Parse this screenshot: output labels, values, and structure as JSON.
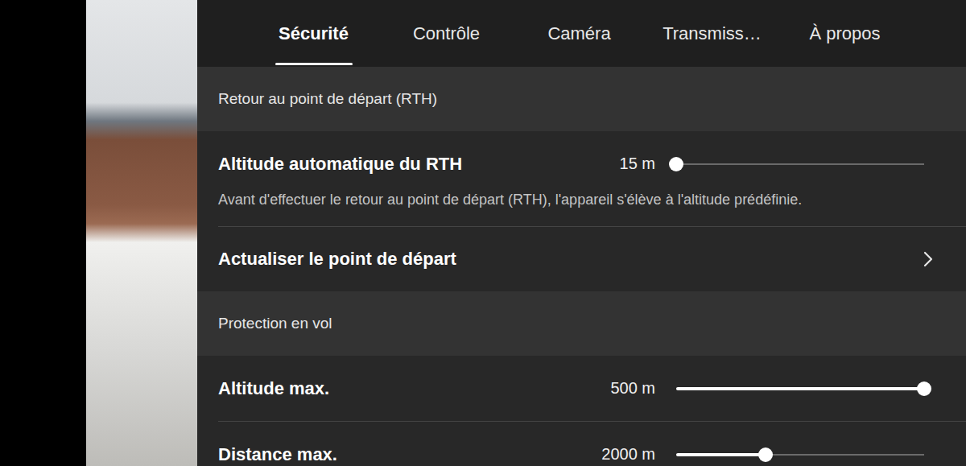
{
  "tabs": [
    {
      "label": "Sécurité",
      "selected": true
    },
    {
      "label": "Contrôle",
      "selected": false
    },
    {
      "label": "Caméra",
      "selected": false
    },
    {
      "label": "Transmiss…",
      "selected": false
    },
    {
      "label": "À propos",
      "selected": false
    }
  ],
  "sections": [
    {
      "title": "Retour au point de départ (RTH)",
      "rows": [
        {
          "kind": "slider",
          "label": "Altitude automatique du RTH",
          "value": "15 m",
          "level": 0,
          "description": "Avant d'effectuer le retour au point de départ (RTH), l'appareil s'élève à l'altitude prédéfinie."
        },
        {
          "kind": "link",
          "label": "Actualiser le point de départ",
          "value": "",
          "level": 0,
          "description": ""
        }
      ]
    },
    {
      "title": "Protection en vol",
      "rows": [
        {
          "kind": "slider",
          "label": "Altitude max.",
          "value": "500 m",
          "level": 1,
          "description": ""
        },
        {
          "kind": "slider",
          "label": "Distance max.",
          "value": "2000 m",
          "level": 0.36,
          "description": ""
        }
      ]
    }
  ]
}
